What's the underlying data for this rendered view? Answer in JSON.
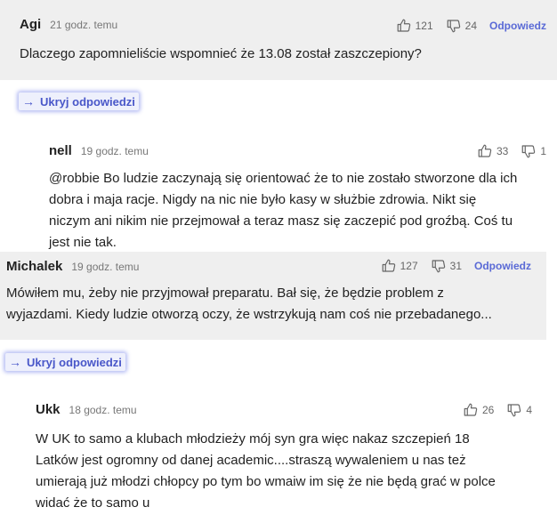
{
  "comments": [
    {
      "author": "Agi",
      "time": "21 godz. temu",
      "likes": "121",
      "dislikes": "24",
      "reply_label": "Odpowiedz",
      "text": "Dlaczego zapomnieliście wspomnieć że 13.08 został zaszczepiony?"
    },
    {
      "author": "nell",
      "time": "19 godz. temu",
      "likes": "33",
      "dislikes": "1",
      "text_lines": [
        "@robbie Bo ludzie zaczynają się orientować że to nie zostało stworzone dla ich",
        "dobra i maja racje. Nigdy na nic nie było kasy w służbie zdrowia. Nikt się",
        "niczym ani nikim nie przejmował a teraz masz się zaczepić pod groźbą. Coś tu",
        "jest nie tak."
      ]
    },
    {
      "author": "Michalek",
      "time": "19 godz. temu",
      "likes": "127",
      "dislikes": "31",
      "reply_label": "Odpowiedz",
      "text_lines": [
        "Mówiłem mu, żeby nie przyjmował preparatu. Bał się, że będzie problem z",
        "wyjazdami. Kiedy ludzie otworzą oczy, że wstrzykują nam coś nie przebadanego..."
      ]
    },
    {
      "author": "Ukk",
      "time": "18 godz. temu",
      "likes": "26",
      "dislikes": "4",
      "text_lines": [
        "W UK to samo a klubach młodzieży mój syn gra więc nakaz szczepień 18",
        "Latków jest ogromny od danej academic....straszą wywaleniem u nas też",
        "umierają już młodzi chłopcy po tym bo wmaiw im się że nie będą grać w polce",
        "widać że to samo u"
      ]
    }
  ],
  "toggles": [
    {
      "arrow": "→",
      "label": "Ukryj odpowiedzi"
    },
    {
      "arrow": "→",
      "label": "Ukryj odpowiedzi"
    }
  ],
  "icons": {
    "like": "thumb-up-icon",
    "dislike": "thumb-down-icon"
  },
  "colors": {
    "accent": "#5a6ad6",
    "comment_bg": "#efefef",
    "toggle_bg": "#eef0fc"
  }
}
